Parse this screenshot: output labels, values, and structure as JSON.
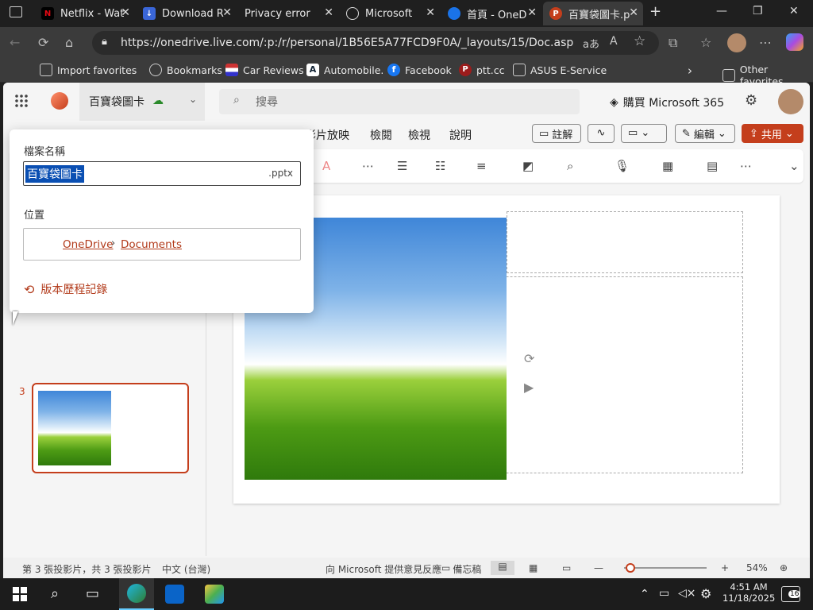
{
  "tabs": [
    {
      "title": "Netflix - Wat",
      "icon": "netflix-icon",
      "color": "#e50914"
    },
    {
      "title": "Download R",
      "icon": "download-icon",
      "color": "#3a66d8"
    },
    {
      "title": "Privacy error",
      "icon": "warning-icon",
      "color": "#d44"
    },
    {
      "title": "Microsoft",
      "icon": "globe-icon",
      "color": "#777"
    },
    {
      "title": "首頁 - OneD",
      "icon": "onedrive-icon",
      "color": "#1a73e8"
    },
    {
      "title": "百寶袋圖卡.p",
      "icon": "powerpoint-icon",
      "color": "#c43e1c"
    }
  ],
  "address": {
    "url": "https://onedrive.live.com/:p:/r/personal/1B56E5A77FCD9F0A/_layouts/15/Doc.aspx?resid=..."
  },
  "favorites": [
    {
      "label": "Import favorites",
      "icon": "import-icon"
    },
    {
      "label": "Bookmarks",
      "icon": "globe-icon"
    },
    {
      "label": "Car Reviews",
      "icon": "flag-icon"
    },
    {
      "label": "Automobile.",
      "icon": "a-icon"
    },
    {
      "label": "Facebook",
      "icon": "facebook-icon"
    },
    {
      "label": "ptt.cc",
      "icon": "ptt-icon"
    },
    {
      "label": "ASUS E-Service",
      "icon": "folder-icon"
    }
  ],
  "other_favorites": "Other favorites",
  "app": {
    "doc_title": "百寶袋圖卡",
    "search_placeholder": "搜尋",
    "buy_label": "購買 Microsoft 365"
  },
  "ribbon_tabs": [
    "影片放映",
    "檢閱",
    "檢視",
    "說明"
  ],
  "ribbon_buttons": {
    "comments": "註解",
    "edit": "編輯",
    "share": "共用"
  },
  "popup": {
    "filename_label": "檔案名稱",
    "filename_value": "百寶袋圖卡",
    "extension": ".pptx",
    "location_label": "位置",
    "location_root": "OneDrive",
    "location_folder": "Documents",
    "version_history": "版本歷程記錄"
  },
  "thumbnail_number": "3",
  "status": {
    "slide_info": "第 3 張投影片，共 3 張投影片",
    "language": "中文 (台灣)",
    "feedback": "向 Microsoft 提供意見反應",
    "notes": "備忘稿",
    "zoom": "54%"
  },
  "clock": {
    "time": "4:51 AM",
    "date": "11/18/2025",
    "notifications": "16"
  }
}
